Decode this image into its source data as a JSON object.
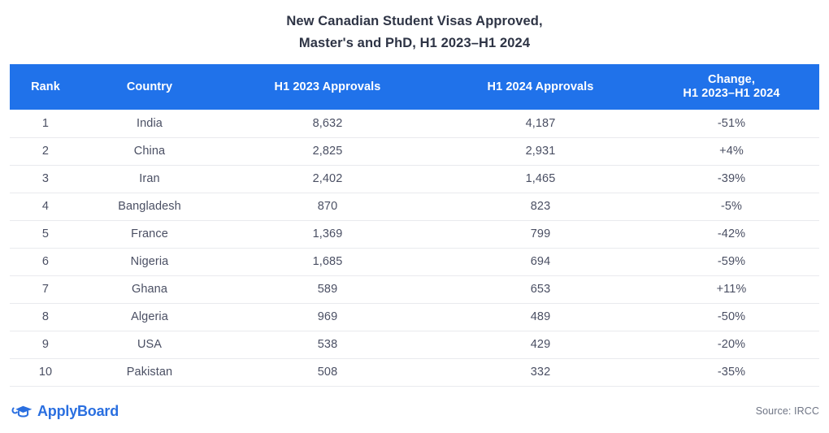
{
  "title": {
    "line1": "New Canadian Student Visas Approved,",
    "line2": "Master's and PhD, H1 2023–H1 2024"
  },
  "table": {
    "headers": {
      "rank": "Rank",
      "country": "Country",
      "h1_2023": "H1 2023 Approvals",
      "h1_2024": "H1 2024 Approvals",
      "change_line1": "Change,",
      "change_line2": "H1 2023–H1 2024"
    },
    "rows": [
      {
        "rank": "1",
        "country": "India",
        "h1_2023": "8,632",
        "h1_2024": "4,187",
        "change": "-51%",
        "direction": "negative"
      },
      {
        "rank": "2",
        "country": "China",
        "h1_2023": "2,825",
        "h1_2024": "2,931",
        "change": "+4%",
        "direction": "positive"
      },
      {
        "rank": "3",
        "country": "Iran",
        "h1_2023": "2,402",
        "h1_2024": "1,465",
        "change": "-39%",
        "direction": "negative"
      },
      {
        "rank": "4",
        "country": "Bangladesh",
        "h1_2023": "870",
        "h1_2024": "823",
        "change": "-5%",
        "direction": "negative"
      },
      {
        "rank": "5",
        "country": "France",
        "h1_2023": "1,369",
        "h1_2024": "799",
        "change": "-42%",
        "direction": "negative"
      },
      {
        "rank": "6",
        "country": "Nigeria",
        "h1_2023": "1,685",
        "h1_2024": "694",
        "change": "-59%",
        "direction": "negative"
      },
      {
        "rank": "7",
        "country": "Ghana",
        "h1_2023": "589",
        "h1_2024": "653",
        "change": "+11%",
        "direction": "positive"
      },
      {
        "rank": "8",
        "country": "Algeria",
        "h1_2023": "969",
        "h1_2024": "489",
        "change": "-50%",
        "direction": "negative"
      },
      {
        "rank": "9",
        "country": "USA",
        "h1_2023": "538",
        "h1_2024": "429",
        "change": "-20%",
        "direction": "negative"
      },
      {
        "rank": "10",
        "country": "Pakistan",
        "h1_2023": "508",
        "h1_2024": "332",
        "change": "-35%",
        "direction": "negative"
      }
    ]
  },
  "footer": {
    "brand_name": "ApplyBoard",
    "brand_icon": "graduation-cap-icon",
    "source": "Source: IRCC"
  },
  "colors": {
    "header_blue": "#2072ea",
    "title_text": "#2e3445",
    "body_text": "#4a4f63",
    "change_negative": "#e8486f",
    "change_positive": "#3aa17e",
    "row_divider": "#e9eaee",
    "brand_blue": "#2a6fe0",
    "source_text": "#6f7585",
    "background": "#ffffff"
  },
  "chart_data": {
    "type": "table",
    "title": "New Canadian Student Visas Approved, Master's and PhD, H1 2023–H1 2024",
    "columns": [
      "Rank",
      "Country",
      "H1 2023 Approvals",
      "H1 2024 Approvals",
      "Change, H1 2023–H1 2024"
    ],
    "categories": [
      "India",
      "China",
      "Iran",
      "Bangladesh",
      "France",
      "Nigeria",
      "Ghana",
      "Algeria",
      "USA",
      "Pakistan"
    ],
    "series": [
      {
        "name": "H1 2023 Approvals",
        "values": [
          8632,
          2825,
          2402,
          870,
          1369,
          1685,
          589,
          969,
          538,
          508
        ]
      },
      {
        "name": "H1 2024 Approvals",
        "values": [
          4187,
          2931,
          1465,
          823,
          799,
          694,
          653,
          489,
          429,
          332
        ]
      },
      {
        "name": "Change, H1 2023–H1 2024 (%)",
        "values": [
          -51,
          4,
          -39,
          -5,
          -42,
          -59,
          11,
          -50,
          -20,
          -35
        ]
      }
    ],
    "rows": [
      [
        1,
        "India",
        8632,
        4187,
        -51
      ],
      [
        2,
        "China",
        2825,
        2931,
        4
      ],
      [
        3,
        "Iran",
        2402,
        1465,
        -39
      ],
      [
        4,
        "Bangladesh",
        870,
        823,
        -5
      ],
      [
        5,
        "France",
        1369,
        799,
        -42
      ],
      [
        6,
        "Nigeria",
        1685,
        694,
        -59
      ],
      [
        7,
        "Ghana",
        589,
        653,
        11
      ],
      [
        8,
        "Algeria",
        969,
        489,
        -50
      ],
      [
        9,
        "USA",
        538,
        429,
        -20
      ],
      [
        10,
        "Pakistan",
        508,
        332,
        -35
      ]
    ],
    "source": "IRCC",
    "xlabel": "",
    "ylabel": "",
    "grid": false,
    "legend": "none"
  }
}
